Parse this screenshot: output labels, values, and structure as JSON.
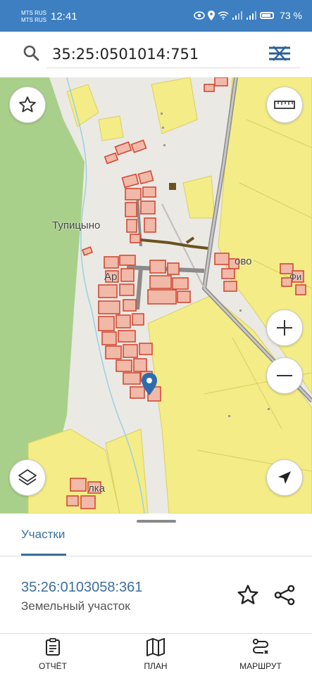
{
  "status_bar": {
    "carrier_1": "MTS RUS",
    "carrier_2": "MTS RUS",
    "time": "12:41",
    "battery": "73 %"
  },
  "search": {
    "value": "35:25:0501014:751"
  },
  "map": {
    "labels": {
      "tupitsyno": "Тупицыно",
      "art": "Ар",
      "ovo": "ово",
      "fi": "Фи",
      "lka": "лка"
    },
    "icons": {
      "favorite": "star-icon",
      "measure": "ruler-icon",
      "zoom_in": "plus-icon",
      "zoom_out": "minus-icon",
      "layers": "layers-icon",
      "location": "navigation-arrow-icon",
      "marker": "location-pin-icon"
    }
  },
  "sheet": {
    "tab_label": "Участки",
    "parcel_number": "35:26:0103058:361",
    "parcel_type": "Земельный участок"
  },
  "nav": {
    "report": "ОТЧЁТ",
    "plan": "ПЛАН",
    "route": "МАРШРУТ"
  },
  "colors": {
    "accent": "#3d7fc0",
    "link": "#3d6f9e",
    "parcel_yellow": "#f4ec86",
    "parcel_red": "#d24a35",
    "forest_green": "#a9d08a"
  }
}
